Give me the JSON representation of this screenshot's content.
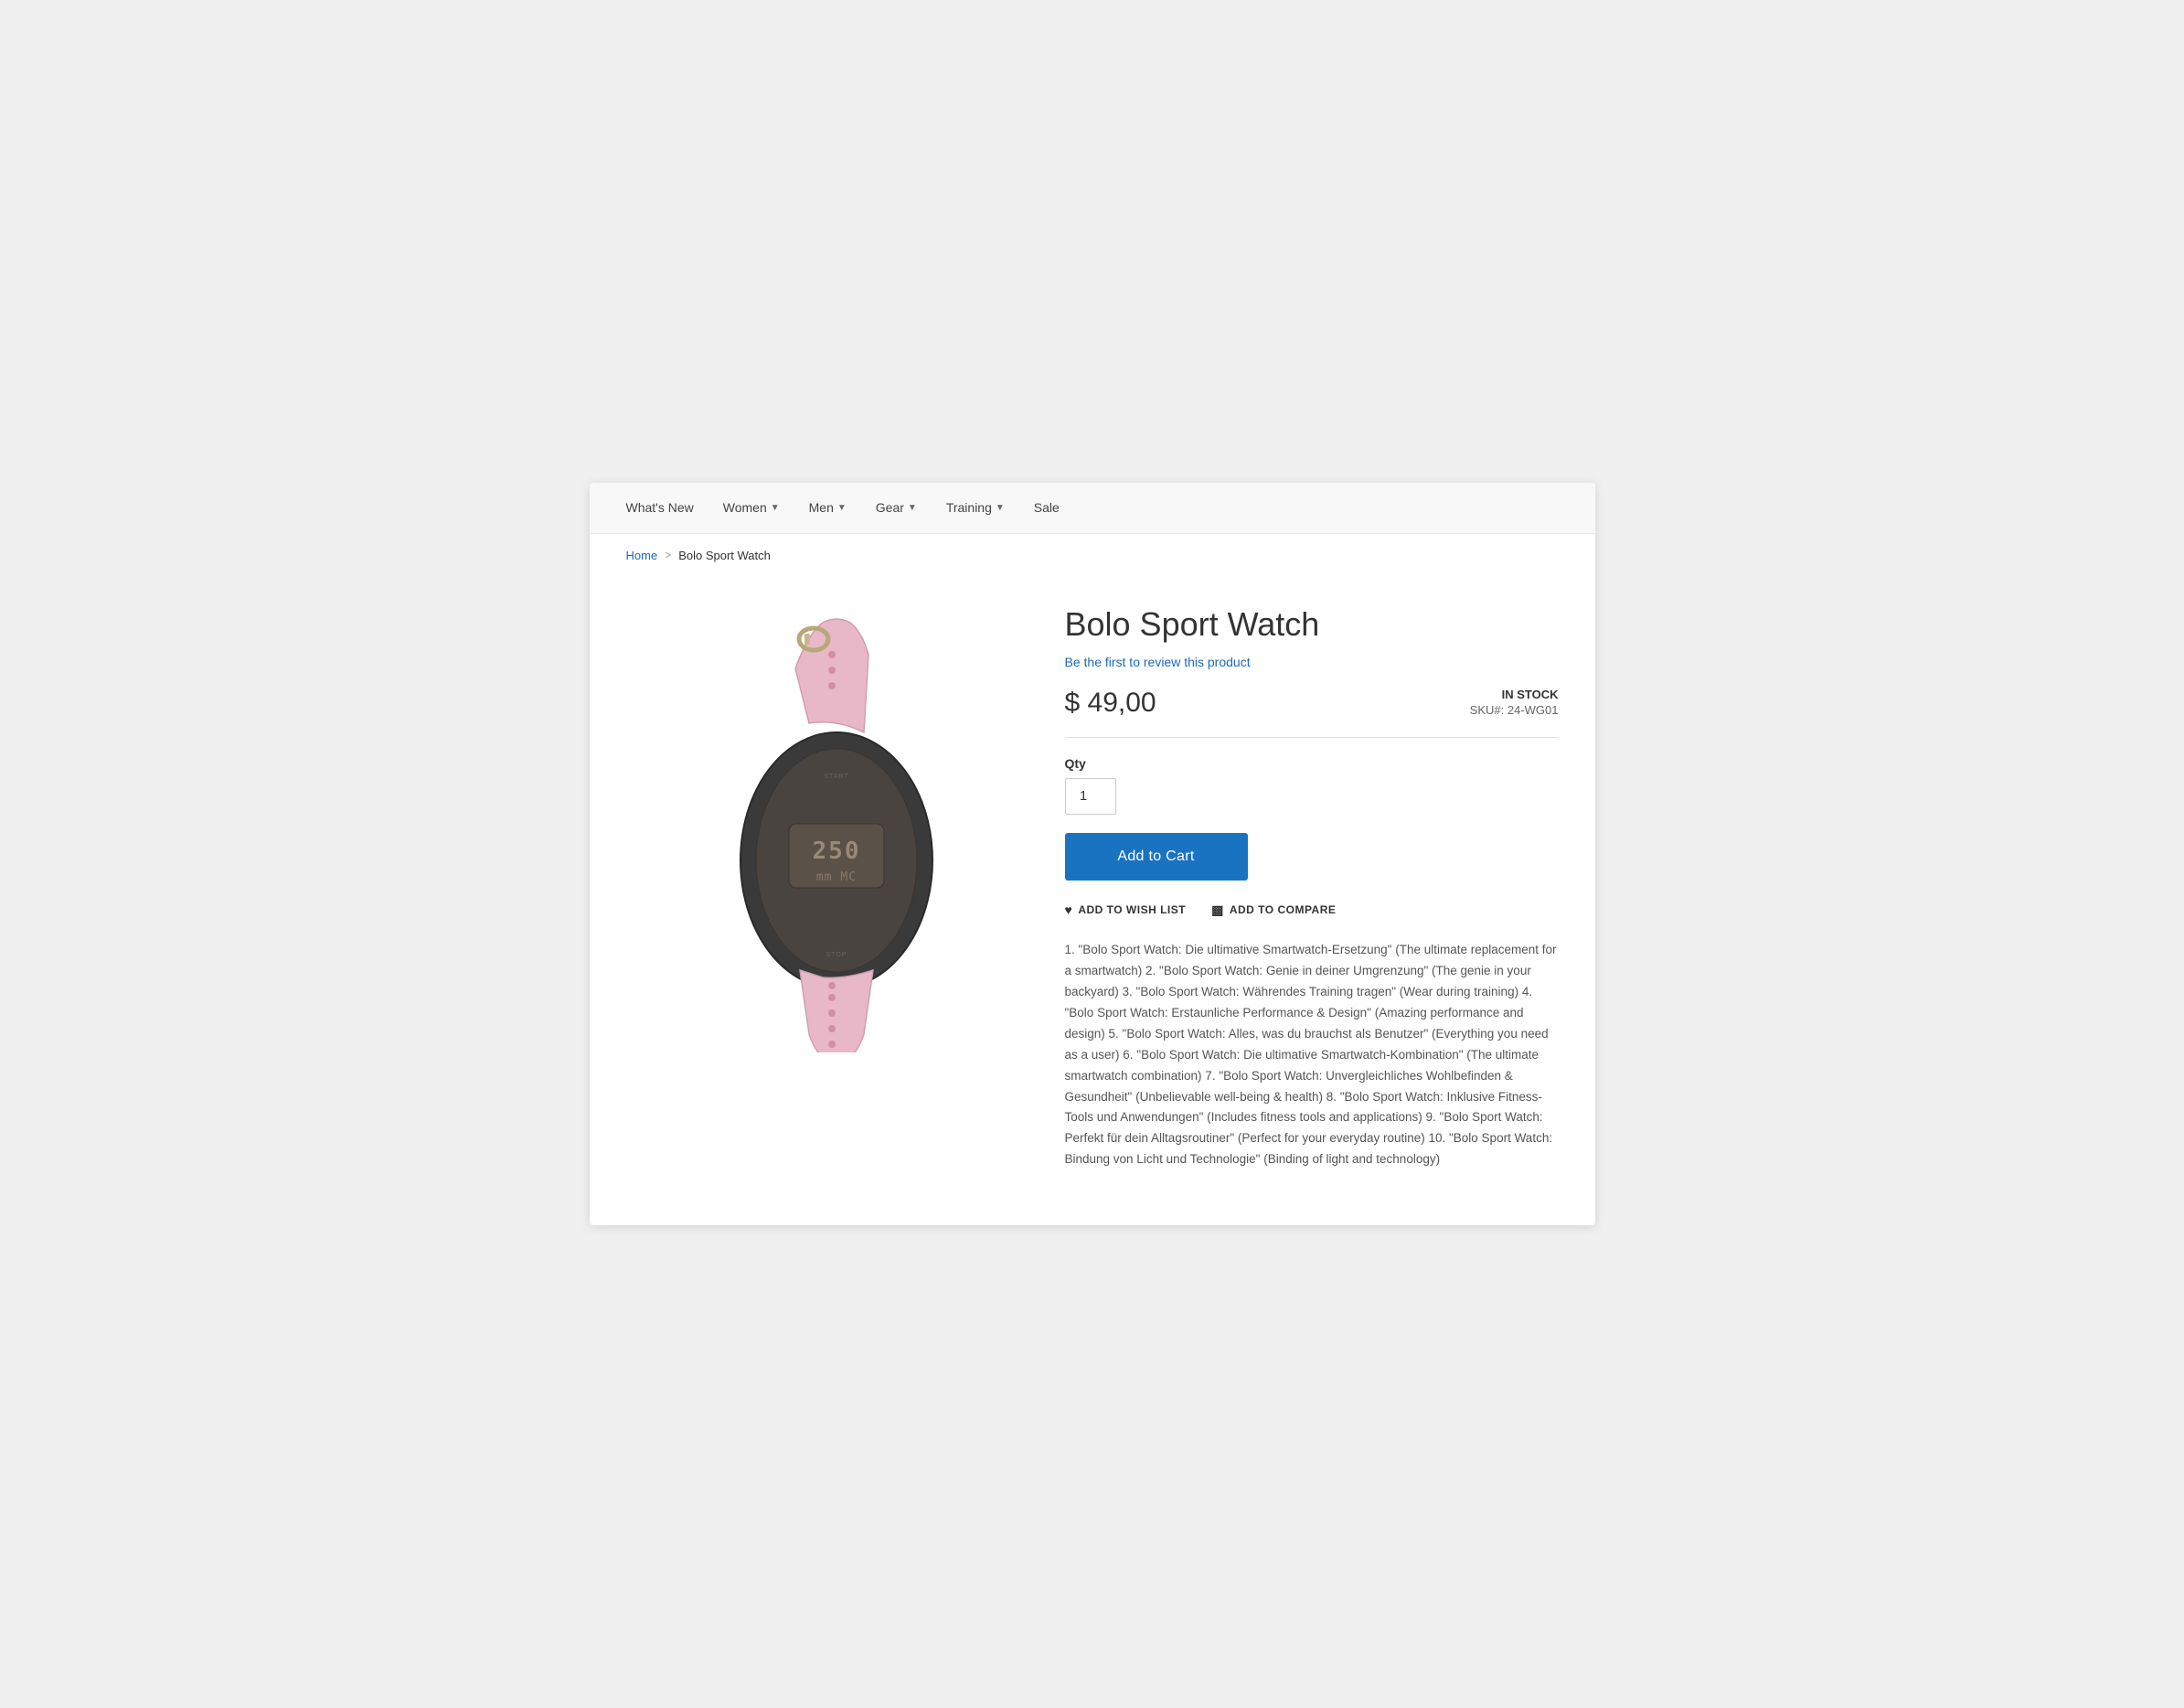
{
  "nav": {
    "items": [
      {
        "label": "What's New",
        "has_dropdown": false
      },
      {
        "label": "Women",
        "has_dropdown": true
      },
      {
        "label": "Men",
        "has_dropdown": true
      },
      {
        "label": "Gear",
        "has_dropdown": true
      },
      {
        "label": "Training",
        "has_dropdown": true
      },
      {
        "label": "Sale",
        "has_dropdown": false
      }
    ]
  },
  "breadcrumb": {
    "home_label": "Home",
    "separator": ">",
    "current": "Bolo Sport Watch"
  },
  "product": {
    "title": "Bolo Sport Watch",
    "review_link": "Be the first to review this product",
    "price": "$ 49,00",
    "availability": "IN STOCK",
    "sku_label": "SKU#:",
    "sku_value": "24-WG01",
    "qty_label": "Qty",
    "qty_value": "1",
    "add_to_cart_label": "Add to Cart",
    "wishlist_label": "ADD TO WISH LIST",
    "compare_label": "ADD TO COMPARE",
    "description": "1. \"Bolo Sport Watch: Die ultimative Smartwatch-Ersetzung\" (The ultimate replacement for a smartwatch) 2. \"Bolo Sport Watch: Genie in deiner Umgrenzung\" (The genie in your backyard) 3. \"Bolo Sport Watch: Währendes Training tragen\" (Wear during training) 4. \"Bolo Sport Watch: Erstaunliche Performance & Design\" (Amazing performance and design) 5. \"Bolo Sport Watch: Alles, was du brauchst als Benutzer\" (Everything you need as a user) 6. \"Bolo Sport Watch: Die ultimative Smartwatch-Kombination\" (The ultimate smartwatch combination) 7. \"Bolo Sport Watch: Unvergleichliches Wohlbefinden & Gesundheit\" (Unbelievable well-being & health) 8. \"Bolo Sport Watch: Inklusive Fitness-Tools und Anwendungen\" (Includes fitness tools and applications) 9. \"Bolo Sport Watch: Perfekt für dein Alltagsroutiner\" (Perfect for your everyday routine) 10. \"Bolo Sport Watch: Bindung von Licht und Technologie\" (Binding of light and technology)"
  }
}
